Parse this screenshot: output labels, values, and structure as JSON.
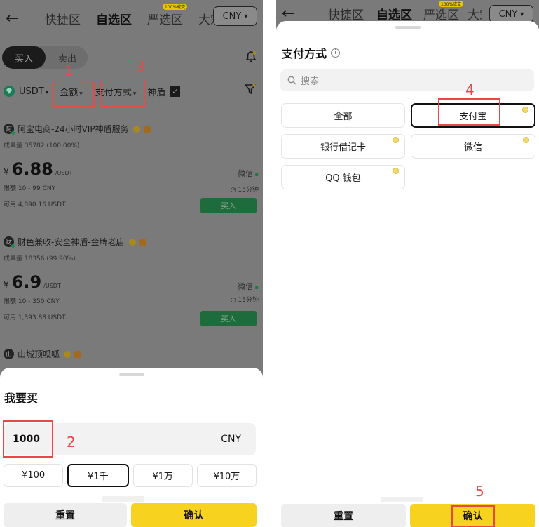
{
  "left": {
    "nav": {
      "back": "←",
      "tabs": [
        "快捷区",
        "自选区",
        "严选区",
        "大宗"
      ],
      "badge": "100%成交",
      "currency": "CNY",
      "currency_chevron": "▾"
    },
    "buy_sell": {
      "buy": "买入",
      "sell": "卖出"
    },
    "filters": {
      "coin": "USDT",
      "amount": "金额",
      "payment": "支付方式",
      "shield": "神盾",
      "chevron": "▾",
      "check": "✓"
    },
    "cards": [
      {
        "avatar": "阿",
        "name": "阿宝电商-24小时VIP神盾服务",
        "orders": "成单量 35782 (100.00%)",
        "yen": "¥",
        "price": "6.88",
        "unit": "/USDT",
        "method": "微信",
        "limit": "限额 10 - 99 CNY",
        "time": "15分钟",
        "available": "可用 4,890.16 USDT",
        "buy": "买入"
      },
      {
        "avatar": "财",
        "name": "财色兼收-安全神盾-金牌老店",
        "orders": "成单量 18356 (99.90%)",
        "yen": "¥",
        "price": "6.9",
        "unit": "/USDT",
        "method": "微信",
        "limit": "限额 10 - 350 CNY",
        "time": "15分钟",
        "available": "可用 1,393.88 USDT",
        "buy": "买入"
      },
      {
        "avatar": "山",
        "name": "山城顶呱呱"
      }
    ],
    "sheet": {
      "title": "我要买",
      "amount": "1000",
      "currency": "CNY",
      "presets": [
        "¥100",
        "¥1千",
        "¥1万",
        "¥10万"
      ],
      "selected_preset": 1,
      "reset": "重置",
      "confirm": "确认"
    },
    "markers": [
      "1",
      "2",
      "3"
    ]
  },
  "right": {
    "nav": {
      "back": "←",
      "tabs": [
        "快捷区",
        "自选区",
        "严选区",
        "大宗"
      ],
      "badge": "100%成交",
      "currency": "CNY",
      "currency_chevron": "▾"
    },
    "sheet": {
      "title": "支付方式",
      "info": "i",
      "search_placeholder": "搜索",
      "methods": [
        "全部",
        "支付宝",
        "银行借记卡",
        "微信",
        "QQ 钱包"
      ],
      "selected_method": 1,
      "reset": "重置",
      "confirm": "确认"
    },
    "markers": [
      "4",
      "5"
    ]
  },
  "colors": {
    "accent_yellow": "#f7d31f",
    "annotation_red": "#e84848",
    "buy_green": "#1e6b3c",
    "overlay_gray": "#7a7a7a"
  }
}
